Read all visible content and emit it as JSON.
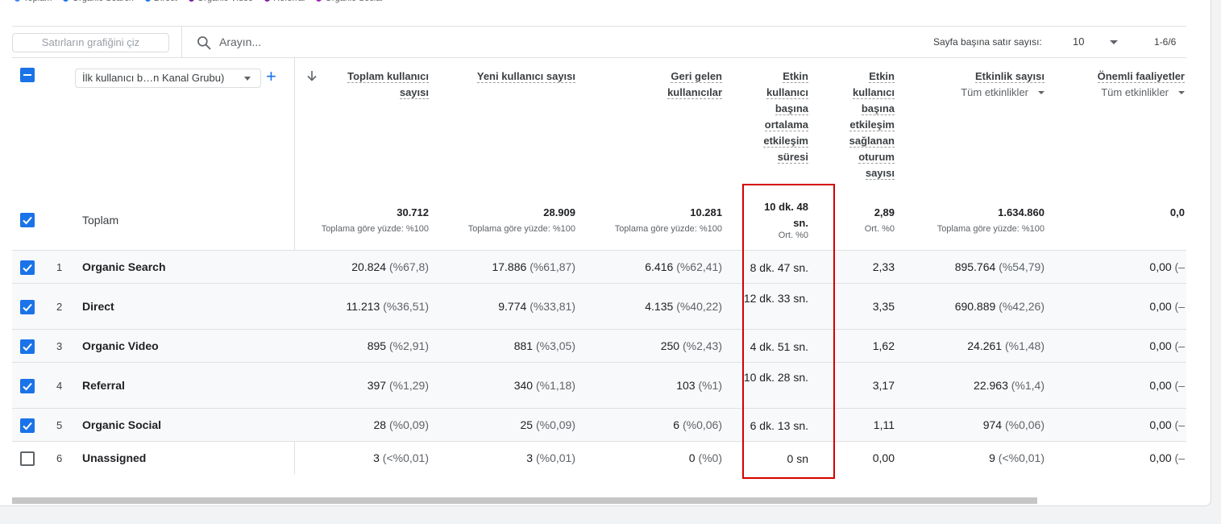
{
  "legend": [
    "Toplam",
    "Organic Search",
    "Direct",
    "Organic Video",
    "Referral",
    "Organic Social"
  ],
  "legend_colors": [
    "#4285f4",
    "#1a73e8",
    "#1a73e8",
    "#7b1fa2",
    "#7b1fa2",
    "#9c27b0"
  ],
  "toolbar": {
    "plot_rows_button": "Satırların grafiğini çiz",
    "search_placeholder": "Arayın...",
    "rows_per_page_label": "Sayfa başına satır sayısı:",
    "rows_per_page_value": "10",
    "page_range": "1-6/6"
  },
  "header": {
    "dimension_select": "İlk kullanıcı b…n Kanal Grubu)",
    "columns": [
      {
        "label_lines": [
          "Toplam kullanıcı",
          "sayısı"
        ]
      },
      {
        "label_lines": [
          "Yeni kullanıcı sayısı"
        ]
      },
      {
        "label_lines": [
          "Geri gelen",
          "kullanıcılar"
        ]
      },
      {
        "label_lines": [
          "Etkin",
          "kullanıcı",
          "başına",
          "ortalama",
          "etkileşim",
          "süresi"
        ]
      },
      {
        "label_lines": [
          "Etkin",
          "kullanıcı",
          "başına",
          "etkileşim",
          "sağlanan",
          "oturum",
          "sayısı"
        ]
      },
      {
        "label_lines": [
          "Etkinlik sayısı"
        ],
        "sub": "Tüm etkinlikler"
      },
      {
        "label_lines": [
          "Önemli faaliyetler"
        ],
        "sub": "Tüm etkinlikler"
      }
    ]
  },
  "totals": {
    "label": "Toplam",
    "values": [
      {
        "value": "30.712",
        "sub": "Toplama göre yüzde: %100"
      },
      {
        "value": "28.909",
        "sub": "Toplama göre yüzde: %100"
      },
      {
        "value": "10.281",
        "sub": "Toplama göre yüzde: %100"
      },
      {
        "value_lines": [
          "10 dk. 48",
          "sn."
        ],
        "sub": "Ort. %0"
      },
      {
        "value": "2,89",
        "sub": "Ort. %0"
      },
      {
        "value": "1.634.860",
        "sub": "Toplama göre yüzde: %100"
      },
      {
        "value": "0,0",
        "sub": ""
      }
    ]
  },
  "rows": [
    {
      "idx": "1",
      "name": "Organic Search",
      "checked": true,
      "cells": [
        [
          "20.824",
          "(%67,8)"
        ],
        [
          "17.886",
          "(%61,87)"
        ],
        [
          "6.416",
          "(%62,41)"
        ],
        [
          "8 dk. 47 sn.",
          ""
        ],
        [
          "2,33",
          ""
        ],
        [
          "895.764",
          "(%54,79)"
        ],
        [
          "0,00",
          "(–"
        ]
      ]
    },
    {
      "idx": "2",
      "name": "Direct",
      "checked": true,
      "cells": [
        [
          "11.213",
          "(%36,51)"
        ],
        [
          "9.774",
          "(%33,81)"
        ],
        [
          "4.135",
          "(%40,22)"
        ],
        [
          "12 dk. 33 sn.",
          ""
        ],
        [
          "3,35",
          ""
        ],
        [
          "690.889",
          "(%42,26)"
        ],
        [
          "0,00",
          "(–"
        ]
      ]
    },
    {
      "idx": "3",
      "name": "Organic Video",
      "checked": true,
      "cells": [
        [
          "895",
          "(%2,91)"
        ],
        [
          "881",
          "(%3,05)"
        ],
        [
          "250",
          "(%2,43)"
        ],
        [
          "4 dk. 51 sn.",
          ""
        ],
        [
          "1,62",
          ""
        ],
        [
          "24.261",
          "(%1,48)"
        ],
        [
          "0,00",
          "(–"
        ]
      ]
    },
    {
      "idx": "4",
      "name": "Referral",
      "checked": true,
      "cells": [
        [
          "397",
          "(%1,29)"
        ],
        [
          "340",
          "(%1,18)"
        ],
        [
          "103",
          "(%1)"
        ],
        [
          "10 dk. 28 sn.",
          ""
        ],
        [
          "3,17",
          ""
        ],
        [
          "22.963",
          "(%1,4)"
        ],
        [
          "0,00",
          "(–"
        ]
      ]
    },
    {
      "idx": "5",
      "name": "Organic Social",
      "checked": true,
      "cells": [
        [
          "28",
          "(%0,09)"
        ],
        [
          "25",
          "(%0,09)"
        ],
        [
          "6",
          "(%0,06)"
        ],
        [
          "6 dk. 13 sn.",
          ""
        ],
        [
          "1,11",
          ""
        ],
        [
          "974",
          "(%0,06)"
        ],
        [
          "0,00",
          "(–"
        ]
      ]
    },
    {
      "idx": "6",
      "name": "Unassigned",
      "checked": false,
      "cells": [
        [
          "3",
          "(<%0,01)"
        ],
        [
          "3",
          "(%0,01)"
        ],
        [
          "0",
          "(%0)"
        ],
        [
          "0 sn",
          ""
        ],
        [
          "0,00",
          ""
        ],
        [
          "9",
          "(<%0,01)"
        ],
        [
          "0,00",
          "(–"
        ]
      ]
    }
  ]
}
